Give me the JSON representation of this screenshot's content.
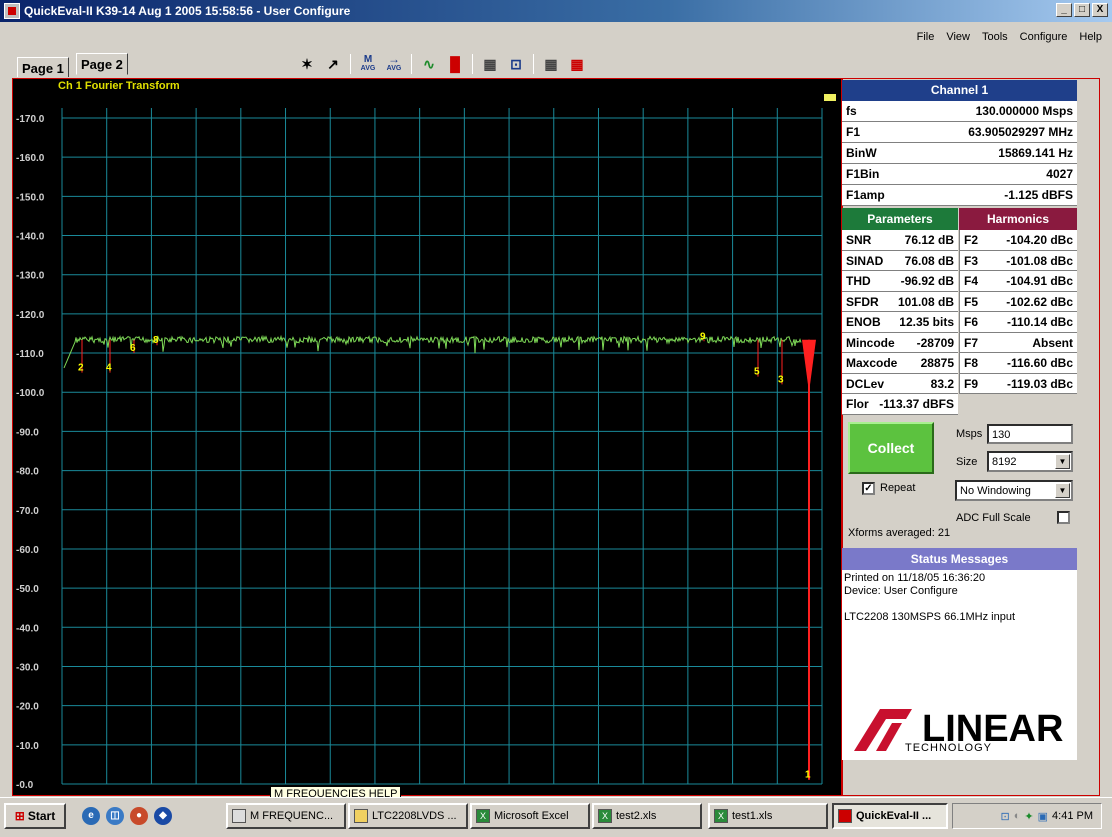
{
  "window": {
    "title": "QuickEval-II K39-14  Aug  1 2005 15:58:56 - User Configure",
    "controls": [
      "_",
      "□",
      "X"
    ]
  },
  "menu": [
    "File",
    "View",
    "Tools",
    "Configure",
    "Help"
  ],
  "tabs": [
    "Page 1",
    "Page 2"
  ],
  "toolbar": {
    "icons": [
      "magic-wand-icon",
      "cursor-icon",
      "m-avg-icon",
      "arrow-avg-icon",
      "waveform-icon",
      "histogram-icon",
      "fft-icon",
      "spectrum-icon",
      "config-icon",
      "config2-icon"
    ],
    "labels": {
      "m_avg": "M",
      "avg": "AVG"
    }
  },
  "plot": {
    "title": "Ch 1 Fourier Transform",
    "y_tick_labels": [
      "-0.0",
      "-10.0",
      "-20.0",
      "-30.0",
      "-40.0",
      "-50.0",
      "-60.0",
      "-70.0",
      "-80.0",
      "-90.0",
      "-100.0",
      "-110.0",
      "-120.0",
      "-130.0",
      "-140.0",
      "-150.0",
      "-160.0",
      "-170.0"
    ],
    "harmonic_markers": [
      {
        "label": "1",
        "color": "#ffff00"
      },
      {
        "label": "2",
        "color": "#ffff00"
      },
      {
        "label": "3",
        "color": "#ffff00"
      },
      {
        "label": "4",
        "color": "#ffff00"
      },
      {
        "label": "5",
        "color": "#ffff00"
      },
      {
        "label": "6",
        "color": "#ffff00"
      },
      {
        "label": "8",
        "color": "#ffff00"
      },
      {
        "label": "9",
        "color": "#ffff00"
      }
    ],
    "colors": {
      "background": "#000000",
      "grid": "#1a8a9a",
      "trace": "#7ed957",
      "harmonic": "#ff2020",
      "marker_text": "#ffff00"
    }
  },
  "chart_data": {
    "type": "line",
    "title": "Ch 1 Fourier Transform",
    "xlabel": "",
    "ylabel": "",
    "ylim": [
      -170,
      0
    ],
    "y_ticks": [
      0,
      -10,
      -20,
      -30,
      -40,
      -50,
      -60,
      -70,
      -80,
      -90,
      -100,
      -110,
      -120,
      -130,
      -140,
      -150,
      -160,
      -170
    ],
    "grid": true,
    "series": [
      {
        "noise_floor_dbfs": -113.4,
        "fundamental_dbfs": -1.125
      }
    ],
    "harmonics": [
      {
        "label": "1",
        "amplitude_dbfs": -1.1
      },
      {
        "label": "2",
        "amplitude_dbfs": -105
      },
      {
        "label": "3",
        "amplitude_dbfs": -102
      },
      {
        "label": "4",
        "amplitude_dbfs": -105
      },
      {
        "label": "5",
        "amplitude_dbfs": -104
      },
      {
        "label": "6",
        "amplitude_dbfs": -110
      },
      {
        "label": "8",
        "amplitude_dbfs": -112
      },
      {
        "label": "9",
        "amplitude_dbfs": -113
      }
    ]
  },
  "channel": {
    "title": "Channel 1",
    "rows": [
      {
        "key": "fs",
        "value": "130.000000 Msps"
      },
      {
        "key": "F1",
        "value": "63.905029297 MHz"
      },
      {
        "key": "BinW",
        "value": "15869.141 Hz"
      },
      {
        "key": "F1Bin",
        "value": "4027"
      },
      {
        "key": "F1amp",
        "value": "-1.125 dBFS"
      }
    ]
  },
  "parameters": {
    "title": "Parameters",
    "rows": [
      {
        "name": "SNR",
        "value": "76.12 dB"
      },
      {
        "name": "SINAD",
        "value": "76.08 dB"
      },
      {
        "name": "THD",
        "value": "-96.92 dB"
      },
      {
        "name": "SFDR",
        "value": "101.08 dB"
      },
      {
        "name": "ENOB",
        "value": "12.35 bits"
      },
      {
        "name": "Mincode",
        "value": "-28709"
      },
      {
        "name": "Maxcode",
        "value": "28875"
      },
      {
        "name": "DCLev",
        "value": "83.2"
      },
      {
        "name": "Flor",
        "value": "-113.37 dBFS"
      }
    ]
  },
  "harmonics": {
    "title": "Harmonics",
    "rows": [
      {
        "name": "F2",
        "value": "-104.20 dBc"
      },
      {
        "name": "F3",
        "value": "-101.08 dBc"
      },
      {
        "name": "F4",
        "value": "-104.91 dBc"
      },
      {
        "name": "F5",
        "value": "-102.62 dBc"
      },
      {
        "name": "F6",
        "value": "-110.14 dBc"
      },
      {
        "name": "F7",
        "value": "Absent"
      },
      {
        "name": "F8",
        "value": "-116.60 dBc"
      },
      {
        "name": "F9",
        "value": "-119.03 dBc"
      }
    ]
  },
  "controls": {
    "collect_label": "Collect",
    "msps_label": "Msps",
    "msps_value": "130",
    "size_label": "Size",
    "size_value": "8192",
    "repeat_label": "Repeat",
    "repeat_checked": "✓",
    "windowing_value": "No Windowing",
    "adc_full_scale_label": "ADC Full Scale",
    "xforms_averaged": "Xforms averaged: 21"
  },
  "status": {
    "title": "Status Messages",
    "lines": [
      "Printed on 11/18/05 16:36:20",
      "Device: User Configure",
      "",
      "LTC2208 130MSPS 66.1MHz input"
    ]
  },
  "logo": {
    "word": "LINEAR",
    "sub": "TECHNOLOGY"
  },
  "tooltip": "M FREQUENCIES HELP",
  "taskbar": {
    "start": "Start",
    "items": [
      {
        "label": "M FREQUENC...",
        "active": false
      },
      {
        "label": "LTC2208LVDS ...",
        "active": false
      },
      {
        "label": "Microsoft Excel",
        "active": false
      },
      {
        "label": "test2.xls",
        "active": false
      },
      {
        "label": "test1.xls",
        "active": false
      },
      {
        "label": "QuickEval-II ...",
        "active": true
      }
    ],
    "clock": "4:41 PM"
  }
}
